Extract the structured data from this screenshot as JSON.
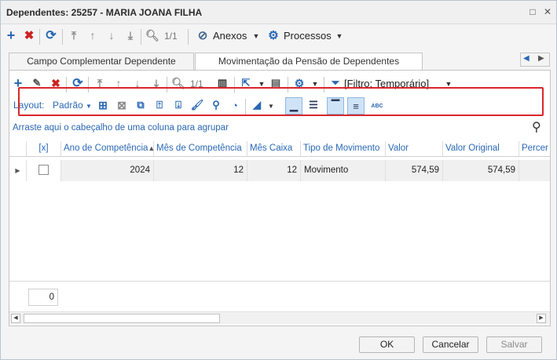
{
  "window": {
    "title": "Dependentes: 25257 - MARIA JOANA FILHA"
  },
  "toolbar": {
    "counter": "1/1",
    "attachments": "Anexos",
    "processes": "Processos"
  },
  "tabs": [
    {
      "label": "Campo Complementar Dependente"
    },
    {
      "label": "Movimentação da Pensão de Dependentes"
    }
  ],
  "inner_toolbar": {
    "counter": "1/1",
    "filter": "[Filtro: Temporário]"
  },
  "layout_bar": {
    "label": "Layout:",
    "value": "Padrão",
    "abc": "ABC"
  },
  "grid": {
    "group_hint": "Arraste aqui o cabeçalho de uma coluna para agrupar",
    "columns": [
      "[x]",
      "Ano de Competência",
      "Mês de Competência",
      "Mês Caixa",
      "Tipo de Movimento",
      "Valor",
      "Valor Original",
      "Percer"
    ],
    "rows": [
      {
        "ano": "2024",
        "mes": "12",
        "mes_caixa": "12",
        "tipo": "Movimento",
        "valor": "574,59",
        "valor_original": "574,59"
      }
    ],
    "footer_count": "0"
  },
  "buttons": {
    "ok": "OK",
    "cancel": "Cancelar",
    "save": "Salvar"
  },
  "colors": {
    "accent": "#2a68b4",
    "delete": "#cc2222",
    "highlight": "#d9262b"
  }
}
